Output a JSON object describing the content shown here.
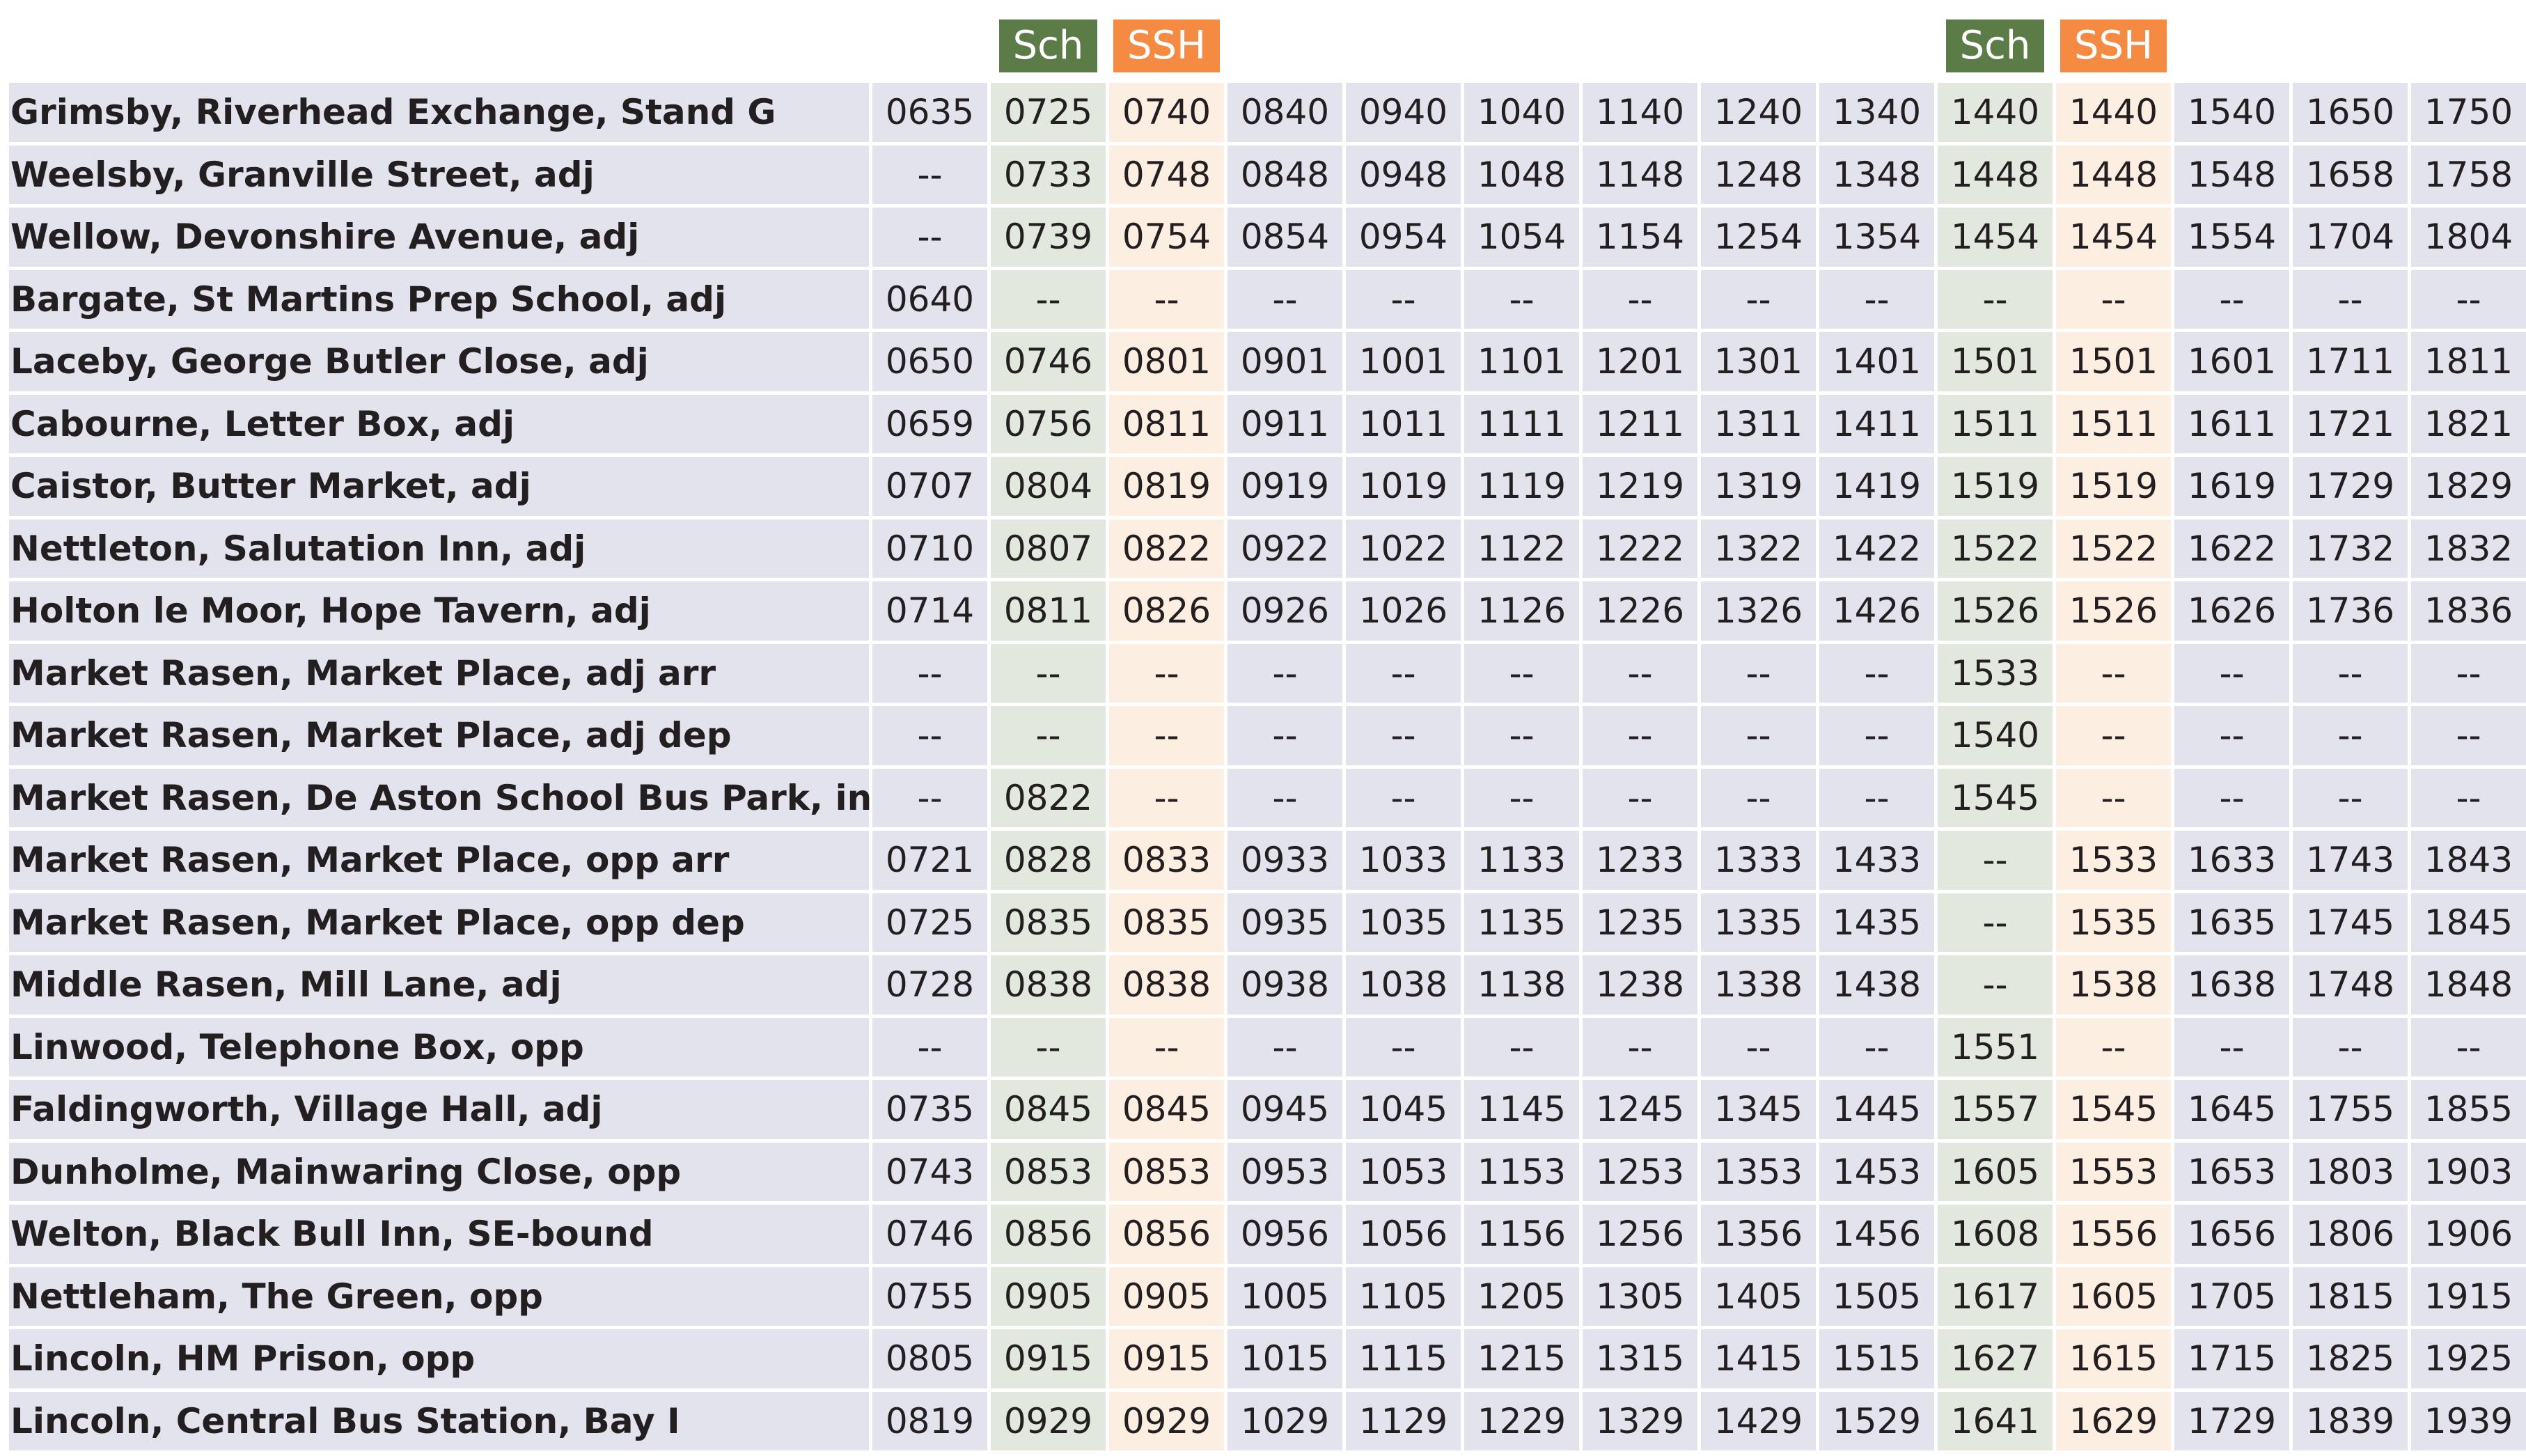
{
  "colors": {
    "sch_badge": "#5b7b47",
    "ssh_badge": "#f58a42",
    "row_bg": "#e3e3ee",
    "sch_bg": "#e2e8dd",
    "ssh_bg": "#fdeee2"
  },
  "columns": [
    {
      "tag": ""
    },
    {
      "tag": "Sch"
    },
    {
      "tag": "SSH"
    },
    {
      "tag": ""
    },
    {
      "tag": ""
    },
    {
      "tag": ""
    },
    {
      "tag": ""
    },
    {
      "tag": ""
    },
    {
      "tag": ""
    },
    {
      "tag": "Sch"
    },
    {
      "tag": "SSH"
    },
    {
      "tag": ""
    },
    {
      "tag": ""
    },
    {
      "tag": ""
    }
  ],
  "rows": [
    {
      "stop": "Grimsby, Riverhead Exchange, Stand G",
      "times": [
        "0635",
        "0725",
        "0740",
        "0840",
        "0940",
        "1040",
        "1140",
        "1240",
        "1340",
        "1440",
        "1440",
        "1540",
        "1650",
        "1750"
      ]
    },
    {
      "stop": "Weelsby, Granville Street, adj",
      "times": [
        "--",
        "0733",
        "0748",
        "0848",
        "0948",
        "1048",
        "1148",
        "1248",
        "1348",
        "1448",
        "1448",
        "1548",
        "1658",
        "1758"
      ]
    },
    {
      "stop": "Wellow, Devonshire Avenue, adj",
      "times": [
        "--",
        "0739",
        "0754",
        "0854",
        "0954",
        "1054",
        "1154",
        "1254",
        "1354",
        "1454",
        "1454",
        "1554",
        "1704",
        "1804"
      ]
    },
    {
      "stop": "Bargate, St Martins Prep School, adj",
      "times": [
        "0640",
        "--",
        "--",
        "--",
        "--",
        "--",
        "--",
        "--",
        "--",
        "--",
        "--",
        "--",
        "--",
        "--"
      ]
    },
    {
      "stop": "Laceby, George Butler Close, adj",
      "times": [
        "0650",
        "0746",
        "0801",
        "0901",
        "1001",
        "1101",
        "1201",
        "1301",
        "1401",
        "1501",
        "1501",
        "1601",
        "1711",
        "1811"
      ]
    },
    {
      "stop": "Cabourne, Letter Box, adj",
      "times": [
        "0659",
        "0756",
        "0811",
        "0911",
        "1011",
        "1111",
        "1211",
        "1311",
        "1411",
        "1511",
        "1511",
        "1611",
        "1721",
        "1821"
      ]
    },
    {
      "stop": "Caistor, Butter Market, adj",
      "times": [
        "0707",
        "0804",
        "0819",
        "0919",
        "1019",
        "1119",
        "1219",
        "1319",
        "1419",
        "1519",
        "1519",
        "1619",
        "1729",
        "1829"
      ]
    },
    {
      "stop": "Nettleton, Salutation Inn, adj",
      "times": [
        "0710",
        "0807",
        "0822",
        "0922",
        "1022",
        "1122",
        "1222",
        "1322",
        "1422",
        "1522",
        "1522",
        "1622",
        "1732",
        "1832"
      ]
    },
    {
      "stop": "Holton le Moor, Hope Tavern, adj",
      "times": [
        "0714",
        "0811",
        "0826",
        "0926",
        "1026",
        "1126",
        "1226",
        "1326",
        "1426",
        "1526",
        "1526",
        "1626",
        "1736",
        "1836"
      ]
    },
    {
      "stop": "Market Rasen, Market Place, adj arr",
      "times": [
        "--",
        "--",
        "--",
        "--",
        "--",
        "--",
        "--",
        "--",
        "--",
        "1533",
        "--",
        "--",
        "--",
        "--"
      ]
    },
    {
      "stop": "Market Rasen, Market Place, adj dep",
      "times": [
        "--",
        "--",
        "--",
        "--",
        "--",
        "--",
        "--",
        "--",
        "--",
        "1540",
        "--",
        "--",
        "--",
        "--"
      ]
    },
    {
      "stop": "Market Rasen, De Aston School Bus Park, in",
      "times": [
        "--",
        "0822",
        "--",
        "--",
        "--",
        "--",
        "--",
        "--",
        "--",
        "1545",
        "--",
        "--",
        "--",
        "--"
      ]
    },
    {
      "stop": "Market Rasen, Market Place, opp arr",
      "times": [
        "0721",
        "0828",
        "0833",
        "0933",
        "1033",
        "1133",
        "1233",
        "1333",
        "1433",
        "--",
        "1533",
        "1633",
        "1743",
        "1843"
      ]
    },
    {
      "stop": "Market Rasen, Market Place, opp dep",
      "times": [
        "0725",
        "0835",
        "0835",
        "0935",
        "1035",
        "1135",
        "1235",
        "1335",
        "1435",
        "--",
        "1535",
        "1635",
        "1745",
        "1845"
      ]
    },
    {
      "stop": "Middle Rasen, Mill Lane, adj",
      "times": [
        "0728",
        "0838",
        "0838",
        "0938",
        "1038",
        "1138",
        "1238",
        "1338",
        "1438",
        "--",
        "1538",
        "1638",
        "1748",
        "1848"
      ]
    },
    {
      "stop": "Linwood, Telephone Box, opp",
      "times": [
        "--",
        "--",
        "--",
        "--",
        "--",
        "--",
        "--",
        "--",
        "--",
        "1551",
        "--",
        "--",
        "--",
        "--"
      ]
    },
    {
      "stop": "Faldingworth, Village Hall, adj",
      "times": [
        "0735",
        "0845",
        "0845",
        "0945",
        "1045",
        "1145",
        "1245",
        "1345",
        "1445",
        "1557",
        "1545",
        "1645",
        "1755",
        "1855"
      ]
    },
    {
      "stop": "Dunholme, Mainwaring Close, opp",
      "times": [
        "0743",
        "0853",
        "0853",
        "0953",
        "1053",
        "1153",
        "1253",
        "1353",
        "1453",
        "1605",
        "1553",
        "1653",
        "1803",
        "1903"
      ]
    },
    {
      "stop": "Welton, Black Bull Inn, SE-bound",
      "times": [
        "0746",
        "0856",
        "0856",
        "0956",
        "1056",
        "1156",
        "1256",
        "1356",
        "1456",
        "1608",
        "1556",
        "1656",
        "1806",
        "1906"
      ]
    },
    {
      "stop": "Nettleham, The Green, opp",
      "times": [
        "0755",
        "0905",
        "0905",
        "1005",
        "1105",
        "1205",
        "1305",
        "1405",
        "1505",
        "1617",
        "1605",
        "1705",
        "1815",
        "1915"
      ]
    },
    {
      "stop": "Lincoln, HM Prison, opp",
      "times": [
        "0805",
        "0915",
        "0915",
        "1015",
        "1115",
        "1215",
        "1315",
        "1415",
        "1515",
        "1627",
        "1615",
        "1715",
        "1825",
        "1925"
      ]
    },
    {
      "stop": "Lincoln, Central Bus Station, Bay I",
      "times": [
        "0819",
        "0929",
        "0929",
        "1029",
        "1129",
        "1229",
        "1329",
        "1429",
        "1529",
        "1641",
        "1629",
        "1729",
        "1839",
        "1939"
      ]
    }
  ]
}
